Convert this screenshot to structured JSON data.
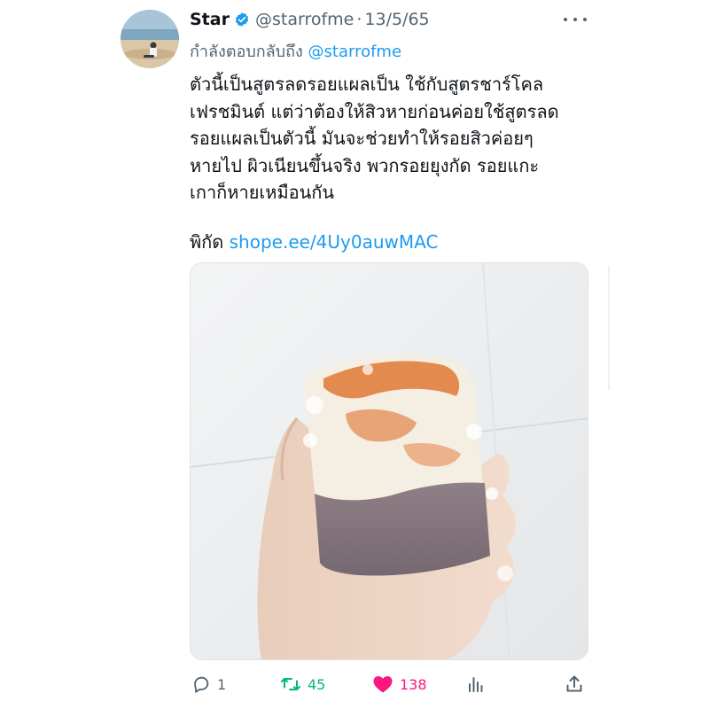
{
  "author": {
    "name": "Star",
    "handle": "@starrofme",
    "date": "13/5/65",
    "verified": true
  },
  "replying": {
    "prefix": "กำลังตอบกลับถึง",
    "mention": "@starrofme"
  },
  "body_lines": [
    "ตัวนี้เป็นสูตรลดรอยแผลเป็น ใช้กับสูตรชาร์โคล",
    "เฟรชมินต์ แต่ว่าต้องให้สิวหายก่อนค่อยใช้สูตรลด",
    "รอยแผลเป็นตัวนี้ มันจะช่วยทำให้รอยสิวค่อยๆ",
    "หายไป ผิวเนียนขึ้นจริง พวกรอยยุงกัด รอยแกะ",
    "เกาก็หายเหมือนกัน"
  ],
  "location": {
    "label": "พิกัด",
    "link": "shope.ee/4Uy0auwMAC"
  },
  "media": {
    "icon": "photo-of-hand-holding-soap"
  },
  "actions": {
    "reply_count": "1",
    "retweet_count": "45",
    "like_count": "138"
  },
  "colors": {
    "accent": "#1d9bf0",
    "retweet": "#00ba7c",
    "like": "#f91880",
    "muted": "#536471"
  }
}
